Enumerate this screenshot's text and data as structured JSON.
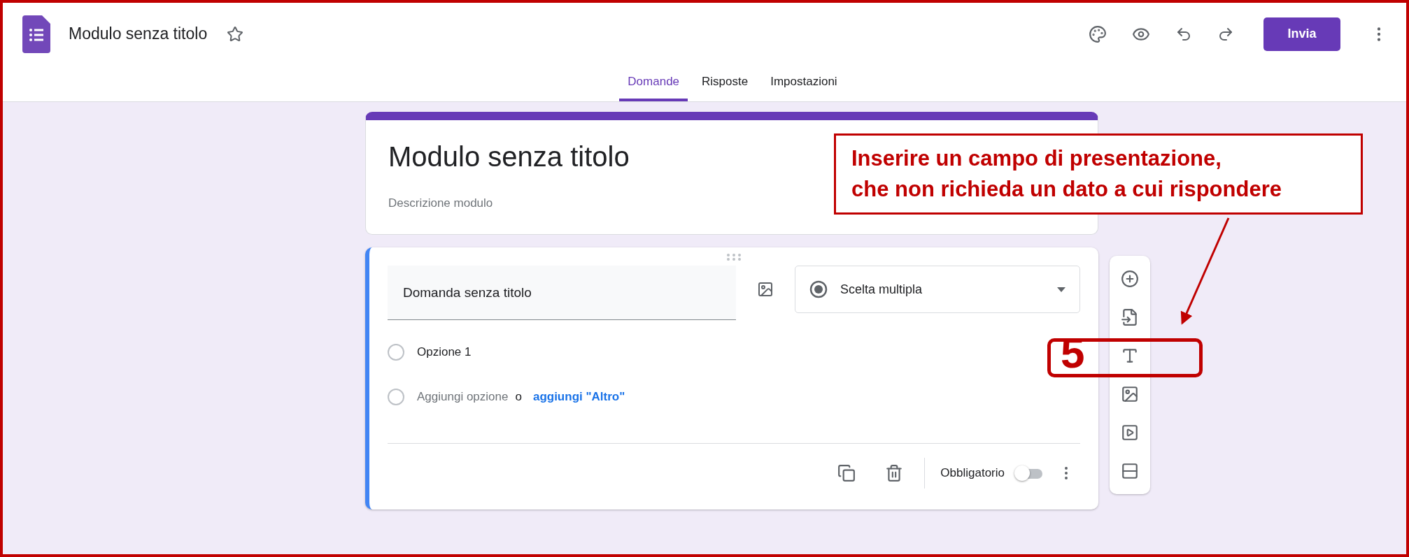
{
  "app": {
    "title": "Modulo senza titolo",
    "send_button": "Invia"
  },
  "tabs": [
    {
      "label": "Domande",
      "selected": true
    },
    {
      "label": "Risposte",
      "selected": false
    },
    {
      "label": "Impostazioni",
      "selected": false
    }
  ],
  "form": {
    "title": "Modulo senza titolo",
    "description": {
      "placeholder": "Descrizione modulo"
    }
  },
  "question": {
    "title": "Domanda senza titolo",
    "type": "Scelta multipla",
    "options": [
      {
        "label": "Opzione 1"
      }
    ],
    "add_option": "Aggiungi opzione",
    "or": "o",
    "add_other": "aggiungi \"Altro\"",
    "required": {
      "label": "Obbligatorio",
      "on": false
    }
  },
  "annotation": {
    "callout_lines": [
      "Inserire un campo di presentazione,",
      "che non richieda un dato a cui rispondere"
    ],
    "step": "5"
  }
}
